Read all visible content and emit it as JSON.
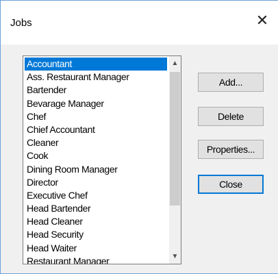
{
  "dialog": {
    "title": "Jobs",
    "close_glyph": "✕"
  },
  "list": {
    "items": [
      "Accountant",
      "Ass. Restaurant Manager",
      "Bartender",
      "Bevarage Manager",
      "Chef",
      "Chief Accountant",
      "Cleaner",
      "Cook",
      "Dining Room Manager",
      "Director",
      "Executive Chef",
      "Head Bartender",
      "Head Cleaner",
      "Head Security",
      "Head Waiter",
      "Restaurant Manager"
    ],
    "selected_index": 0,
    "scroll_up_glyph": "▲",
    "scroll_down_glyph": "▼"
  },
  "buttons": {
    "add": "Add...",
    "delete": "Delete",
    "properties": "Properties...",
    "close": "Close"
  }
}
